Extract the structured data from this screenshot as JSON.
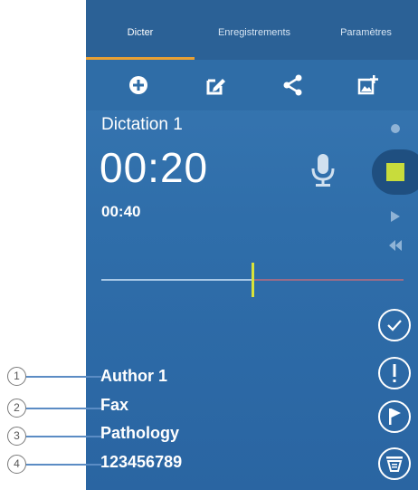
{
  "tabs": [
    {
      "label": "Dicter"
    },
    {
      "label": "Enregistrements"
    },
    {
      "label": "Paramètres"
    }
  ],
  "toolbar": {
    "icons": [
      "add-icon",
      "edit-icon",
      "share-icon",
      "add-image-icon"
    ]
  },
  "dictation": {
    "title": "Dictation 1",
    "elapsed": "00:20",
    "total": "00:40",
    "progress": 0.5
  },
  "side_controls": [
    "check-icon",
    "priority-icon",
    "flag-icon",
    "filter-icon"
  ],
  "metadata": [
    {
      "callout": "1",
      "value": "Author 1"
    },
    {
      "callout": "2",
      "value": "Fax"
    },
    {
      "callout": "3",
      "value": "Pathology"
    },
    {
      "callout": "4",
      "value": "123456789"
    }
  ],
  "colors": {
    "accent": "#e9a033",
    "stop": "#c8dc3c",
    "playhead": "#d8e33a",
    "background": "#2f6eaa"
  }
}
